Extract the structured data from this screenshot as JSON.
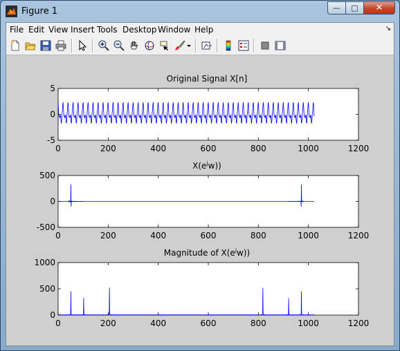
{
  "window": {
    "title": "Figure 1",
    "controls": {
      "minimize": "—",
      "maximize": "□",
      "close": "✕"
    }
  },
  "menubar": {
    "items": [
      "File",
      "Edit",
      "View",
      "Insert",
      "Tools",
      "Desktop",
      "Window",
      "Help"
    ],
    "dock_arrow": "↘"
  },
  "toolbar": {
    "icons": [
      "new-figure-icon",
      "open-file-icon",
      "save-icon",
      "print-icon",
      "select-arrow-icon",
      "zoom-in-icon",
      "zoom-out-icon",
      "pan-hand-icon",
      "rotate-3d-icon",
      "data-cursor-icon",
      "brush-icon",
      "brush-dropdown-icon",
      "link-plot-icon",
      "insert-colorbar-icon",
      "insert-legend-icon",
      "hide-plot-tools-icon",
      "show-plot-tools-icon"
    ]
  },
  "chart_data": [
    {
      "type": "line",
      "title": "Original Signal X[n]",
      "xlim": [
        0,
        1200
      ],
      "ylim": [
        -5,
        5
      ],
      "xticks": [
        "0",
        "200",
        "400",
        "600",
        "800",
        "1000",
        "1200"
      ],
      "yticks": [
        "5",
        "0",
        "-5"
      ],
      "series_color": "#0000ff",
      "description_values": {
        "n_range": [
          0,
          1023
        ],
        "amplitude_range": [
          -2.6,
          2.4
        ],
        "period_samples": 20
      }
    },
    {
      "type": "line",
      "title_prefix": "X(e",
      "title_sup": "j",
      "title_suffix": "w))",
      "xlim": [
        0,
        1200
      ],
      "ylim": [
        -500,
        500
      ],
      "xticks": [
        "0",
        "200",
        "400",
        "600",
        "800",
        "1000",
        "1200"
      ],
      "yticks": [
        "500",
        "0",
        "-500"
      ],
      "series_color": "#0000ff",
      "spikes": [
        {
          "x": 51,
          "y": 330
        },
        {
          "x": 52,
          "y": -100
        },
        {
          "x": 972,
          "y": 330
        },
        {
          "x": 971,
          "y": -100
        }
      ]
    },
    {
      "type": "line",
      "title_prefix": "Magnitude of X(e",
      "title_sup": "j",
      "title_suffix": "w))",
      "xlim": [
        0,
        1200
      ],
      "ylim": [
        0,
        1000
      ],
      "xticks": [
        "0",
        "200",
        "400",
        "600",
        "800",
        "1000",
        "1200"
      ],
      "yticks": [
        "1000",
        "500",
        "0"
      ],
      "series_color": "#0000ff",
      "peaks": [
        {
          "x": 51,
          "y": 450
        },
        {
          "x": 102,
          "y": 330
        },
        {
          "x": 205,
          "y": 520
        },
        {
          "x": 818,
          "y": 520
        },
        {
          "x": 921,
          "y": 320
        },
        {
          "x": 972,
          "y": 450
        }
      ]
    }
  ]
}
